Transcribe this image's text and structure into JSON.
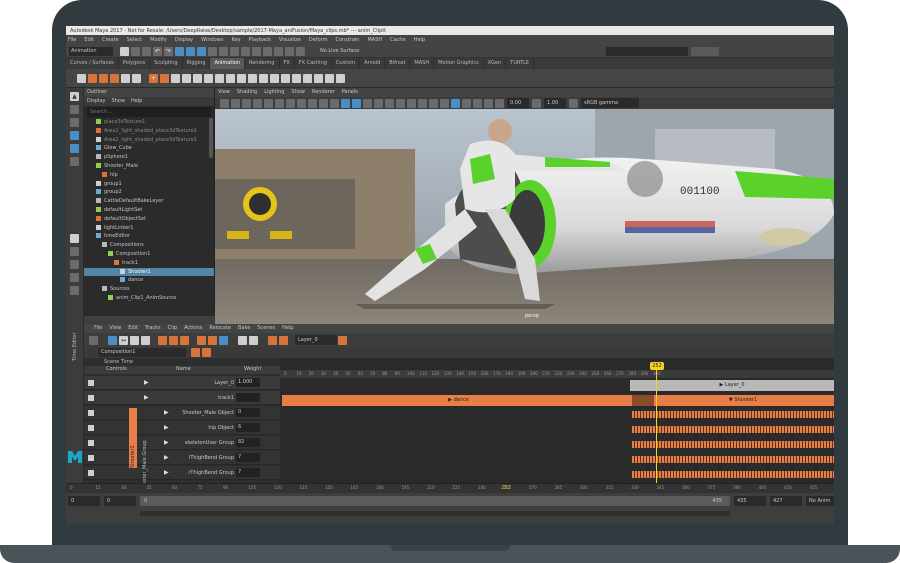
{
  "app": {
    "title": "Autodesk Maya 2017 - Not for Resale: /Users/DeepRaise/Desktop/sample/2017-Maya_aniFusion/Maya_clips.mb* --- anim_Cliptt"
  },
  "menubar": {
    "items": [
      "File",
      "Edit",
      "Create",
      "Select",
      "Modify",
      "Display",
      "Windows",
      "Key",
      "Playback",
      "Visualize",
      "Deform",
      "Constrain",
      "MASH",
      "Cache",
      "Help"
    ]
  },
  "statusline": {
    "mode": "Animation",
    "live_surface": "No Live Surface",
    "search_placeholder": ""
  },
  "shelf": {
    "tabs": [
      "Curves / Surfaces",
      "Polygons",
      "Sculpting",
      "Rigging",
      "Animation",
      "Rendering",
      "FX",
      "FX Caching",
      "Custom",
      "Arnold",
      "Bifrost",
      "MASH",
      "Motion Graphics",
      "XGen",
      "TURTLE"
    ],
    "active_tab": "Animation"
  },
  "outliner": {
    "title": "Outliner",
    "menus": [
      "Display",
      "Show",
      "Help"
    ],
    "search_placeholder": "Search...",
    "items": [
      {
        "label": "place3dTexture1",
        "indent": 2,
        "kind": "dim"
      },
      {
        "label": "Area1_light_shaded_place3dTexture1",
        "indent": 2,
        "kind": "dim"
      },
      {
        "label": "Area2_light_shaded_place3dTexture1",
        "indent": 2,
        "kind": "dim"
      },
      {
        "label": "Glow_Cube",
        "indent": 2,
        "kind": "normal"
      },
      {
        "label": "pSphere1",
        "indent": 2,
        "kind": "normal"
      },
      {
        "label": "Shooter_Male",
        "indent": 2,
        "kind": "normal"
      },
      {
        "label": "hip",
        "indent": 3,
        "kind": "normal"
      },
      {
        "label": "group1",
        "indent": 2,
        "kind": "normal"
      },
      {
        "label": "group2",
        "indent": 2,
        "kind": "normal"
      },
      {
        "label": "CattleDefaultBakeLayer",
        "indent": 2,
        "kind": "normal"
      },
      {
        "label": "defaultLightSet",
        "indent": 2,
        "kind": "normal"
      },
      {
        "label": "defaultObjectSet",
        "indent": 2,
        "kind": "normal"
      },
      {
        "label": "lightLinker1",
        "indent": 2,
        "kind": "normal"
      },
      {
        "label": "timeEditor",
        "indent": 2,
        "kind": "normal"
      },
      {
        "label": "Compositions",
        "indent": 3,
        "kind": "normal"
      },
      {
        "label": "Composition1",
        "indent": 4,
        "kind": "normal"
      },
      {
        "label": "track1",
        "indent": 5,
        "kind": "normal"
      },
      {
        "label": "Shooter1",
        "indent": 6,
        "kind": "selected"
      },
      {
        "label": "dance",
        "indent": 6,
        "kind": "normal"
      },
      {
        "label": "Sources",
        "indent": 3,
        "kind": "normal"
      },
      {
        "label": "anim_Clip1_AnimSource",
        "indent": 4,
        "kind": "normal"
      }
    ]
  },
  "viewport": {
    "menus": [
      "View",
      "Shading",
      "Lighting",
      "Show",
      "Renderer",
      "Panels"
    ],
    "camera_label": "persp",
    "field_a": "0.00",
    "field_b": "1.00",
    "color_space": "sRGB gamma",
    "ship_number": "001100"
  },
  "time_editor": {
    "side_label": "Time Editor",
    "menus": [
      "File",
      "View",
      "Edit",
      "Tracks",
      "Clip",
      "Actions",
      "Relocate",
      "Bake",
      "Scenes",
      "Help"
    ],
    "layer_field": "Layer_0",
    "composition": "Composition1",
    "scene_time": "Scene Time",
    "col_controls": "Controls",
    "col_name": "Name",
    "col_weight": "Weight",
    "rows": [
      {
        "name": "Layer_0",
        "weight": "1.000"
      },
      {
        "name": "track1",
        "weight": ""
      },
      {
        "name": "Shooter_Male Object",
        "weight": "0"
      },
      {
        "name": "hip Object",
        "weight": "6"
      },
      {
        "name": "skeletonUser Group",
        "weight": "82"
      },
      {
        "name": "lThighBend Group",
        "weight": "7"
      },
      {
        "name": "rThighBend Group",
        "weight": "7"
      }
    ],
    "vertical_labels": [
      "Shooter1",
      "Shooter_Male Group"
    ],
    "ruler_ticks": [
      "0",
      "10",
      "20",
      "30",
      "40",
      "50",
      "60",
      "70",
      "80",
      "90",
      "100",
      "110",
      "120",
      "130",
      "140",
      "150",
      "160",
      "170",
      "180",
      "190",
      "200",
      "210",
      "220",
      "230",
      "240",
      "250",
      "260",
      "270",
      "280",
      "290",
      "300"
    ],
    "current_frame": "252",
    "layer_clip": "Layer_0",
    "clip_dance": "dance",
    "clip_shooter": "Shooter1"
  },
  "timeslider": {
    "ticks": [
      "0",
      "15",
      "30",
      "45",
      "60",
      "75",
      "90",
      "105",
      "120",
      "135",
      "150",
      "165",
      "180",
      "195",
      "210",
      "225",
      "240",
      "255",
      "270",
      "285",
      "300",
      "315",
      "330",
      "345",
      "360",
      "375",
      "390",
      "405",
      "420",
      "435"
    ],
    "current": "252",
    "range_start": "0",
    "range_start_b": "0",
    "range_inner": "0",
    "range_end": "435",
    "range_end_b": "435",
    "range_max": "427",
    "anim_layer": "No Anim"
  },
  "colors": {
    "accent_orange": "#e67e45",
    "selection_blue": "#5285a6",
    "suit_green": "#5bd22c",
    "playhead_yellow": "#f1d61b",
    "maya_logo": "#17a7c8"
  }
}
